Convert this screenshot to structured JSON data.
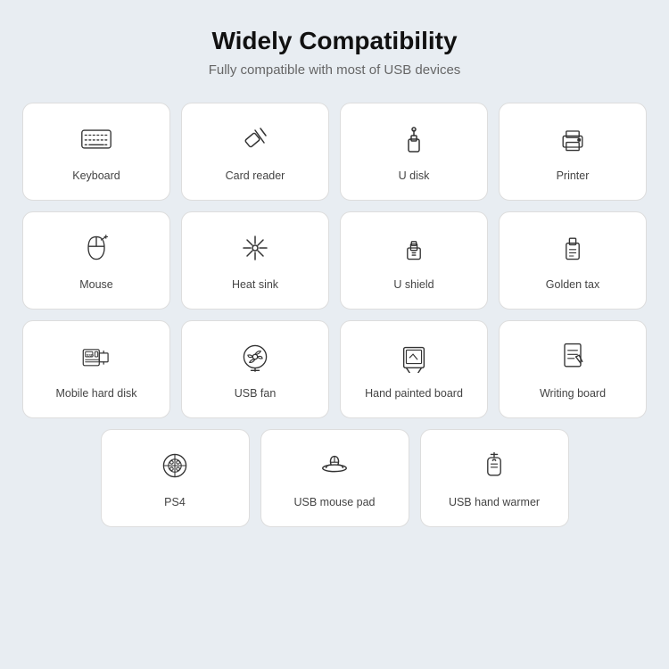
{
  "header": {
    "title": "Widely Compatibility",
    "subtitle": "Fully compatible with most of USB devices"
  },
  "row1": [
    {
      "id": "keyboard",
      "label": "Keyboard"
    },
    {
      "id": "card-reader",
      "label": "Card reader"
    },
    {
      "id": "u-disk",
      "label": "U disk"
    },
    {
      "id": "printer",
      "label": "Printer"
    }
  ],
  "row2": [
    {
      "id": "mouse",
      "label": "Mouse"
    },
    {
      "id": "heat-sink",
      "label": "Heat sink"
    },
    {
      "id": "u-shield",
      "label": "U shield"
    },
    {
      "id": "golden-tax",
      "label": "Golden tax"
    }
  ],
  "row3": [
    {
      "id": "mobile-hard-disk",
      "label": "Mobile hard disk"
    },
    {
      "id": "usb-fan",
      "label": "USB fan"
    },
    {
      "id": "hand-painted-board",
      "label": "Hand painted board"
    },
    {
      "id": "writing-board",
      "label": "Writing board"
    }
  ],
  "row4": [
    {
      "id": "ps4",
      "label": "PS4"
    },
    {
      "id": "usb-mouse-pad",
      "label": "USB mouse pad"
    },
    {
      "id": "usb-hand-warmer",
      "label": "USB hand warmer"
    }
  ]
}
